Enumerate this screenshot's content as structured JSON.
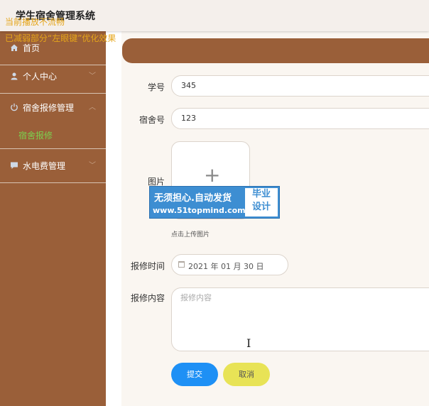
{
  "header": {
    "title": "学生宿舍管理系统"
  },
  "notices": {
    "line1": "当前播放不流畅",
    "line2": "已减弱部分“左眼键”优化效果"
  },
  "sidebar": {
    "items": [
      {
        "label": "首页",
        "icon": "home-icon"
      },
      {
        "label": "个人中心",
        "icon": "user-icon",
        "arrow": "﹀"
      },
      {
        "label": "宿舍报修管理",
        "icon": "power-icon",
        "arrow": "︿"
      },
      {
        "label": "水电费管理",
        "icon": "chat-icon",
        "arrow": "﹀"
      }
    ],
    "submenu": {
      "label": "宿舍报修"
    }
  },
  "form": {
    "student_id": {
      "label": "学号",
      "value": "345"
    },
    "dorm_no": {
      "label": "宿舍号",
      "value": "123"
    },
    "image": {
      "label": "图片",
      "hint": "点击上传图片"
    },
    "repair_time": {
      "label": "报修时间",
      "value": "2021 年 01 月 30 日"
    },
    "repair_content": {
      "label": "报修内容",
      "placeholder": "报修内容"
    },
    "submit_label": "提交",
    "cancel_label": "取消"
  },
  "watermark": {
    "line1": "无须担心.自动发货",
    "line2": "www.51topmind.com",
    "badge_top": "毕业",
    "badge_bottom": "设计"
  },
  "colors": {
    "sidebar_bg": "#9a5f39",
    "active_submenu": "#7bd14f",
    "notice": "#e5a51a",
    "submit_btn": "#1e90f5",
    "cancel_btn": "#e8e356"
  }
}
